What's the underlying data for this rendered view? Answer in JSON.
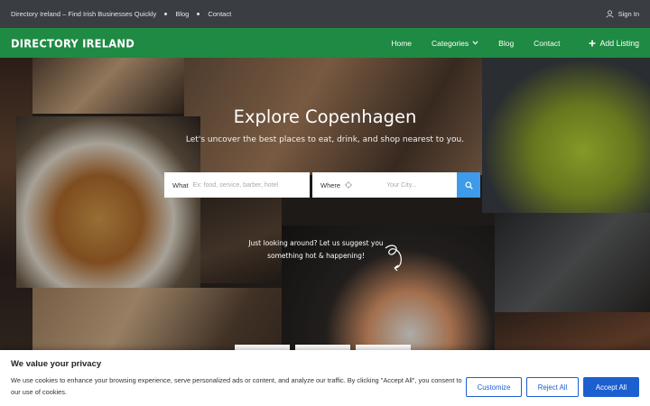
{
  "topbar": {
    "site_link": "Directory Ireland – Find Irish Businesses Quickly",
    "blog": "Blog",
    "contact": "Contact",
    "signin": "Sign In",
    "user_icon": "user-icon"
  },
  "nav": {
    "logo": "DIRECTORY IRELAND",
    "home": "Home",
    "categories": "Categories",
    "blog": "Blog",
    "contact": "Contact",
    "add_listing": "Add Listing",
    "plus_icon": "plus-icon",
    "chevron_icon": "chevron-down-icon"
  },
  "hero": {
    "title": "Explore Copenhagen",
    "subtitle": "Let's uncover the best places to eat, drink, and shop nearest to you.",
    "suggest_line1": "Just looking around? Let us suggest you",
    "suggest_line2": "something hot & happening!"
  },
  "search": {
    "what_label": "What",
    "what_placeholder": "Ex: food, service, barber, hotel",
    "where_label": "Where",
    "where_placeholder": "Your City...",
    "button_icon": "search-icon",
    "location_icon": "crosshair-icon"
  },
  "cookie": {
    "title": "We value your privacy",
    "text": "We use cookies to enhance your browsing experience, serve personalized ads or content, and analyze our traffic. By clicking \"Accept All\", you consent to our use of cookies.",
    "customize": "Customize",
    "reject": "Reject All",
    "accept": "Accept All"
  },
  "colors": {
    "nav_green": "#1e8a43",
    "topbar": "#3a3d42",
    "search_blue": "#3d9be9",
    "cookie_blue": "#1b5fd1"
  }
}
